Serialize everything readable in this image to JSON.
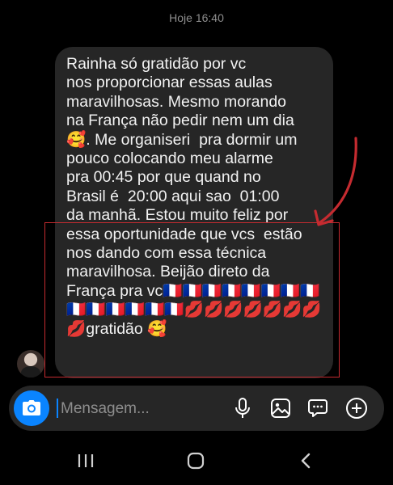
{
  "timestamp": "Hoje 16:40",
  "message": {
    "text": "Rainha só gratidão por vc\nnos proporcionar essas aulas\nmaravilhosas. Mesmo morando\nna França não pedir nem um dia\n🥰. Me organiseri  pra dormir um\npouco colocando meu alarme\npra 00:45 por que quand no\nBrasil é  20:00 aqui sao  01:00\nda manhã. Estou muito feliz por\nessa oportunidade que vcs  estão\nnos dando com essa técnica\nmaravilhosa. Beijão direto da\nFrança pra vc🇫🇷🇫🇷🇫🇷🇫🇷🇫🇷🇫🇷🇫🇷🇫🇷\n🇫🇷🇫🇷🇫🇷🇫🇷🇫🇷🇫🇷💋💋💋💋💋💋💋\n💋gratidão 🥰"
  },
  "composer": {
    "placeholder": "Mensagem..."
  },
  "icons": {
    "camera": "camera-icon",
    "mic": "microphone-icon",
    "gallery": "gallery-icon",
    "sticker": "sticker-icon",
    "add": "plus-icon",
    "recents": "recent-apps-icon",
    "home": "home-icon",
    "back": "back-icon"
  },
  "colors": {
    "accent": "#0a84ff",
    "bubble": "#262626",
    "annotation": "#c52b30"
  }
}
